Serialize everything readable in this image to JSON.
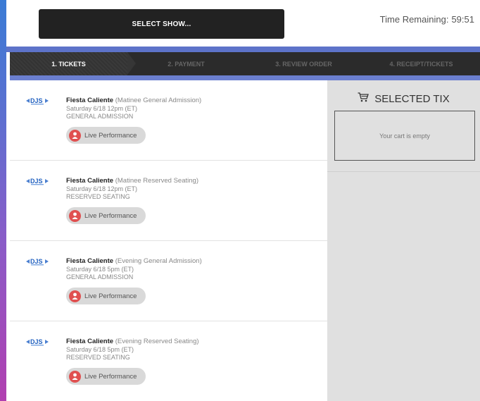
{
  "header": {
    "select_show_label": "SELECT SHOW...",
    "timer_label": "Time Remaining:",
    "timer_value": "59:51"
  },
  "steps": [
    {
      "label": "1. TICKETS",
      "active": true
    },
    {
      "label": "2. PAYMENT",
      "active": false
    },
    {
      "label": "3. REVIEW ORDER",
      "active": false
    },
    {
      "label": "4. RECEIPT/TICKETS",
      "active": false
    }
  ],
  "shows": [
    {
      "name": "Fiesta Caliente",
      "type": "(Matinee General Admission)",
      "datetime": "Saturday 6/18 12pm (ET)",
      "seating": "GENERAL ADMISSION",
      "badge": "Live Performance"
    },
    {
      "name": "Fiesta Caliente",
      "type": "(Matinee Reserved Seating)",
      "datetime": "Saturday 6/18 12pm (ET)",
      "seating": "RESERVED SEATING",
      "badge": "Live Performance"
    },
    {
      "name": "Fiesta Caliente",
      "type": "(Evening General Admission)",
      "datetime": "Saturday 6/18 5pm (ET)",
      "seating": "GENERAL ADMISSION",
      "badge": "Live Performance"
    },
    {
      "name": "Fiesta Caliente",
      "type": "(Evening Reserved Seating)",
      "datetime": "Saturday 6/18 5pm (ET)",
      "seating": "RESERVED SEATING",
      "badge": "Live Performance"
    }
  ],
  "cart": {
    "title": "SELECTED TIX",
    "empty_text": "Your cart is empty"
  },
  "icons": {
    "cart": "cart-icon",
    "badge": "person-icon",
    "logo": "djs-logo"
  },
  "colors": {
    "accent_blue": "#5d73c9",
    "badge_red": "#e05050",
    "dark_bar": "#2b2b2b"
  }
}
